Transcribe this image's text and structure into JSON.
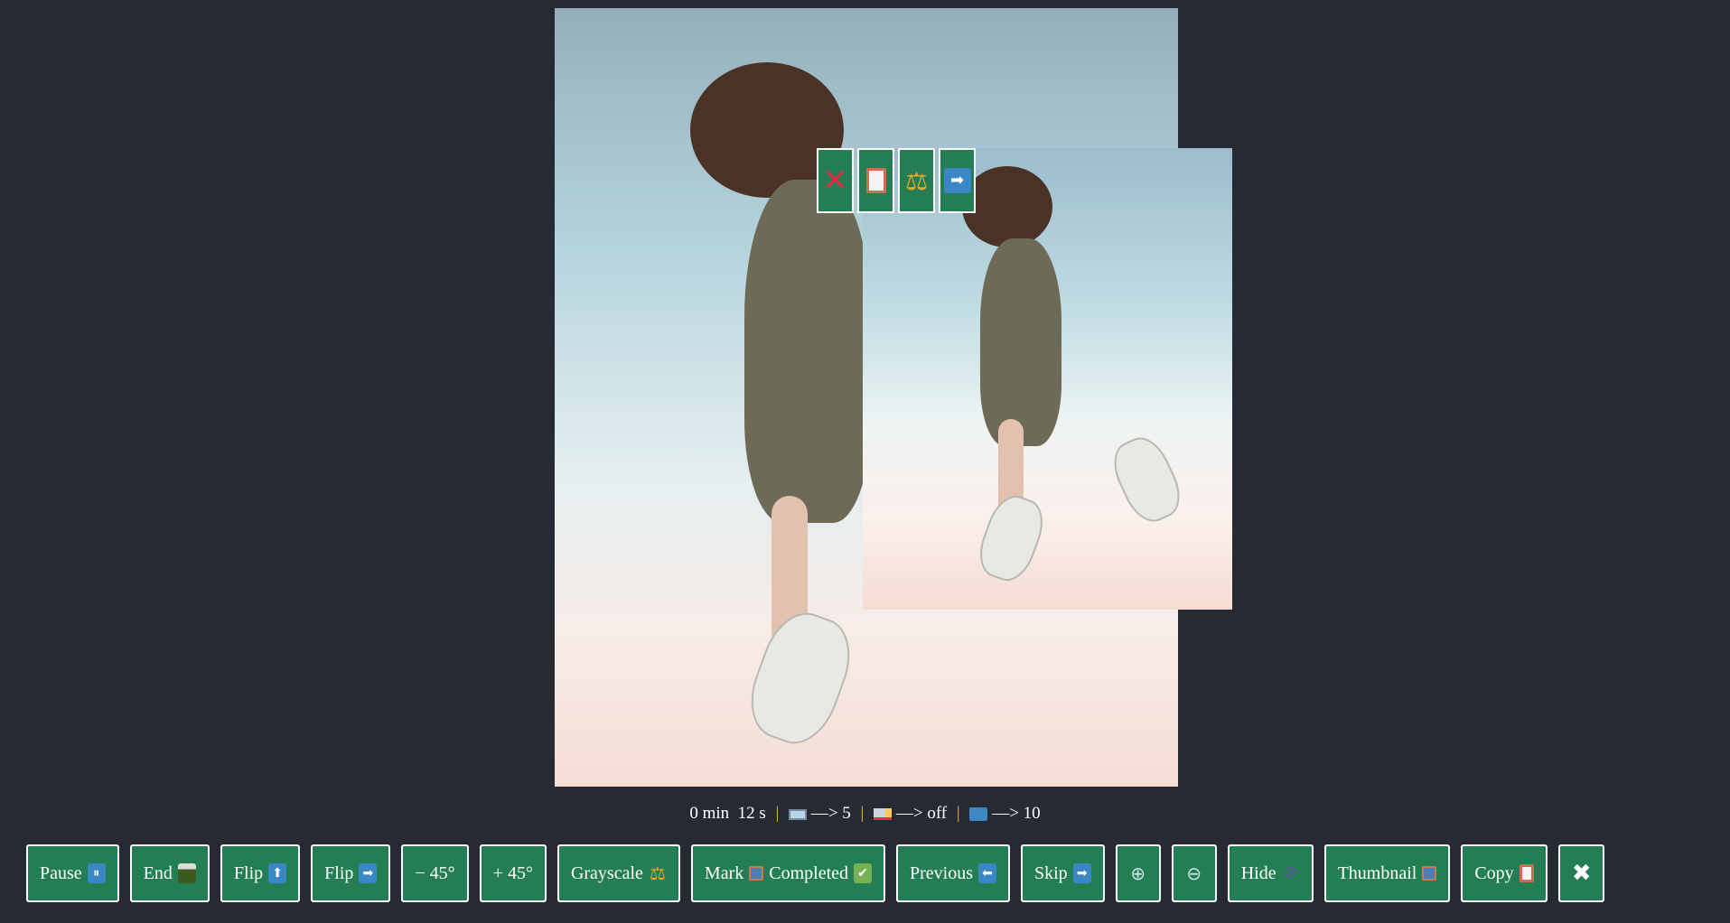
{
  "viewer": {
    "main_image_alt": "Woman jumping against sky",
    "thumbnail_alt": "Woman jumping against sky (thumbnail)"
  },
  "overlay_buttons": [
    {
      "icon": "close-x-icon",
      "glyph": "✕"
    },
    {
      "icon": "clipboard-icon",
      "glyph": ""
    },
    {
      "icon": "scales-icon",
      "glyph": "⚖"
    },
    {
      "icon": "arrow-right-icon",
      "glyph": "➡"
    }
  ],
  "status": {
    "time": "0 min  12 s",
    "film_value": "—> 5",
    "truck_value": "—> off",
    "folder_value": "—> 10"
  },
  "toolbar": {
    "pause": "Pause",
    "end": "End",
    "flip_vertical": "Flip",
    "flip_horizontal": "Flip",
    "rotate_minus": "− 45°",
    "rotate_plus": "+ 45°",
    "grayscale": "Grayscale",
    "mark": "Mark",
    "completed": "Completed",
    "previous": "Previous",
    "skip": "Skip",
    "hide": "Hide",
    "thumbnail": "Thumbnail",
    "copy": "Copy",
    "close_glyph": "✖"
  },
  "colors": {
    "background": "#262a34",
    "button": "#237e53",
    "button_border": "#ffffff",
    "separator": "#e8b54a"
  }
}
